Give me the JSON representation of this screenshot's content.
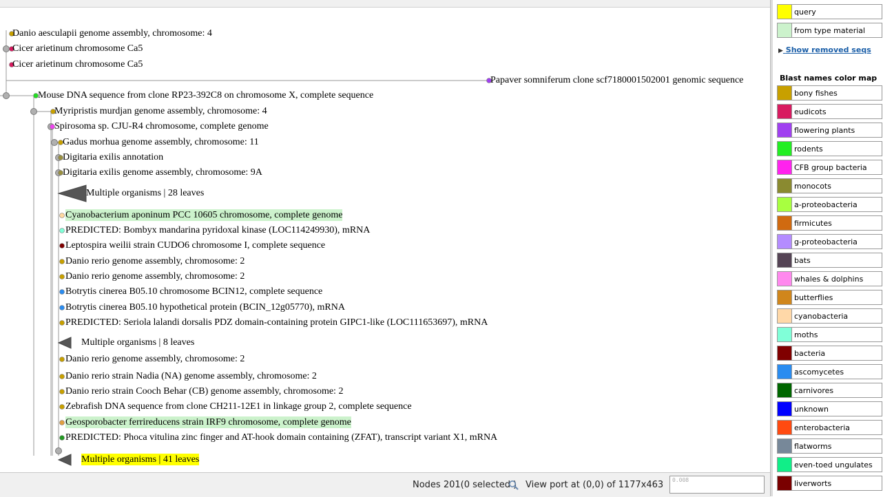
{
  "tree": {
    "leaves": [
      {
        "label": "Danio aesculapii genome assembly, chromosome: 4",
        "dot": "#c8a000",
        "highlight": ""
      },
      {
        "label": "Cicer arietinum chromosome Ca5",
        "dot": "#d81b60",
        "highlight": ""
      },
      {
        "label": "Cicer arietinum chromosome Ca5",
        "dot": "#d81b60",
        "highlight": ""
      },
      {
        "label": "Papaver somniferum clone scf7180001502001 genomic sequence",
        "dot": "#a040f0",
        "highlight": ""
      },
      {
        "label": "Mouse DNA sequence from clone RP23-392C8 on chromosome X, complete sequence",
        "dot": "#22dd22",
        "highlight": ""
      },
      {
        "label": "Myripristis murdjan genome assembly, chromosome: 4",
        "dot": "#c8a000",
        "highlight": ""
      },
      {
        "label": "Spirosoma sp. CJU-R4 chromosome, complete genome",
        "dot": "#ee44ee",
        "highlight": ""
      },
      {
        "label": "Gadus morhua genome assembly, chromosome: 11",
        "dot": "#c8a000",
        "highlight": ""
      },
      {
        "label": "Digitaria exilis annotation",
        "dot": "#9a9040",
        "highlight": ""
      },
      {
        "label": "Digitaria exilis genome assembly, chromosome: 9A",
        "dot": "#9a9040",
        "highlight": ""
      },
      {
        "label": "Multiple organisms | 28 leaves",
        "dot": "",
        "highlight": ""
      },
      {
        "label": "Cyanobacterium aponinum PCC 10605 chromosome, complete genome",
        "dot": "#ffd8a0",
        "highlight": "green"
      },
      {
        "label": "PREDICTED: Bombyx mandarina pyridoxal kinase (LOC114249930), mRNA",
        "dot": "#80ffd8",
        "highlight": ""
      },
      {
        "label": "Leptospira weilii strain CUDO6 chromosome I, complete sequence",
        "dot": "#800000",
        "highlight": ""
      },
      {
        "label": "Danio rerio genome assembly, chromosome: 2",
        "dot": "#c8a000",
        "highlight": ""
      },
      {
        "label": "Danio rerio genome assembly, chromosome: 2",
        "dot": "#c8a000",
        "highlight": ""
      },
      {
        "label": "Botrytis cinerea B05.10 chromosome BCIN12, complete sequence",
        "dot": "#2a8cf0",
        "highlight": ""
      },
      {
        "label": "Botrytis cinerea B05.10 hypothetical protein (BCIN_12g05770), mRNA",
        "dot": "#2a8cf0",
        "highlight": ""
      },
      {
        "label": "PREDICTED: Seriola lalandi dorsalis PDZ domain-containing protein GIPC1-like (LOC111653697), mRNA",
        "dot": "#c8a000",
        "highlight": ""
      },
      {
        "label": "Multiple organisms | 8 leaves",
        "dot": "",
        "highlight": ""
      },
      {
        "label": "Danio rerio genome assembly, chromosome: 2",
        "dot": "#c8a000",
        "highlight": ""
      },
      {
        "label": "Danio rerio strain Nadia (NA) genome assembly, chromosome: 2",
        "dot": "#c8a000",
        "highlight": ""
      },
      {
        "label": "Danio rerio strain Cooch Behar (CB) genome assembly, chromosome: 2",
        "dot": "#c8a000",
        "highlight": ""
      },
      {
        "label": "Zebrafish DNA sequence from clone CH211-12E1 in linkage group 2, complete sequence",
        "dot": "#c8a000",
        "highlight": ""
      },
      {
        "label": "Geosporobacter ferrireducens strain IRF9 chromosome, complete genome",
        "dot": "#e0a040",
        "highlight": "green"
      },
      {
        "label": "PREDICTED: Phoca vitulina zinc finger and AT-hook domain containing (ZFAT), transcript variant X1, mRNA",
        "dot": "#229922",
        "highlight": ""
      },
      {
        "label": "Multiple organisms | 41 leaves",
        "dot": "",
        "highlight": "yellow"
      }
    ]
  },
  "statusbar": {
    "nodes": "Nodes 201(0 selected )",
    "viewport": "View port at (0,0)  of 1177x463",
    "zoom": "0.008"
  },
  "legend": {
    "query_label": "query",
    "query_color": "#ffff00",
    "type_material_label": "from type material",
    "type_material_color": "#ccf2cc",
    "show_removed": "Show removed seqs",
    "title": "Blast names color map",
    "items": [
      {
        "label": "bony fishes",
        "color": "#c8a000"
      },
      {
        "label": "eudicots",
        "color": "#d81b60"
      },
      {
        "label": "flowering plants",
        "color": "#a040f0"
      },
      {
        "label": "rodents",
        "color": "#22ee22"
      },
      {
        "label": "CFB group bacteria",
        "color": "#ff22ee"
      },
      {
        "label": "monocots",
        "color": "#8a8a30"
      },
      {
        "label": "a-proteobacteria",
        "color": "#a8ff40"
      },
      {
        "label": "firmicutes",
        "color": "#d06a10"
      },
      {
        "label": "g-proteobacteria",
        "color": "#b48cff"
      },
      {
        "label": "bats",
        "color": "#554455"
      },
      {
        "label": "whales & dolphins",
        "color": "#ff88ee"
      },
      {
        "label": "butterflies",
        "color": "#d0861c"
      },
      {
        "label": "cyanobacteria",
        "color": "#ffd8a8"
      },
      {
        "label": "moths",
        "color": "#80ffd8"
      },
      {
        "label": "bacteria",
        "color": "#800000"
      },
      {
        "label": "ascomycetes",
        "color": "#2a8cf0"
      },
      {
        "label": "carnivores",
        "color": "#006600"
      },
      {
        "label": "unknown",
        "color": "#0000ff"
      },
      {
        "label": "enterobacteria",
        "color": "#ff4a10"
      },
      {
        "label": "flatworms",
        "color": "#778899"
      },
      {
        "label": "even-toed ungulates",
        "color": "#11ee88"
      },
      {
        "label": "liverworts",
        "color": "#7a0000"
      }
    ]
  }
}
